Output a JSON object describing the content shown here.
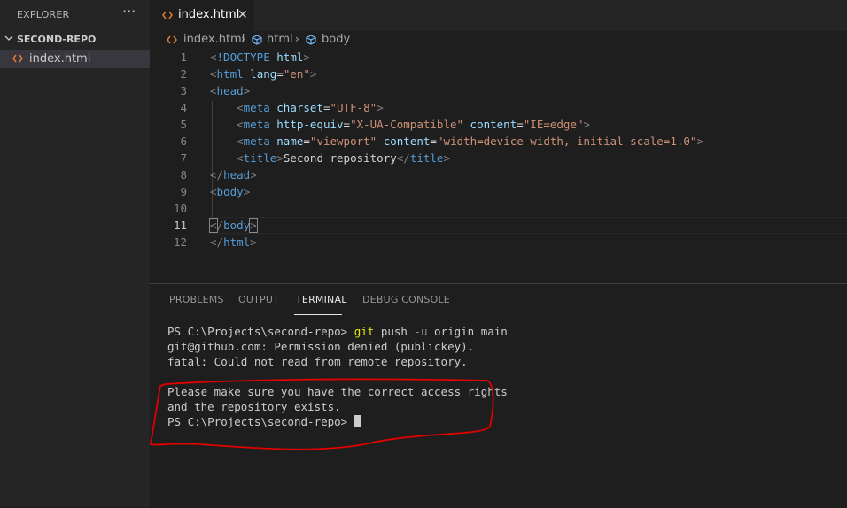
{
  "explorer": {
    "title": "EXPLORER",
    "more": "···",
    "folder": "SECOND-REPO",
    "file": "index.html"
  },
  "tab": {
    "label": "index.html",
    "close": "✕"
  },
  "breadcrumb": {
    "file": "index.html",
    "html": "html",
    "body": "body",
    "sep": "›"
  },
  "editor": {
    "line_numbers": [
      "1",
      "2",
      "3",
      "4",
      "5",
      "6",
      "7",
      "8",
      "9",
      "10",
      "11",
      "12"
    ],
    "active_line": 11
  },
  "panel": {
    "tabs": [
      "PROBLEMS",
      "OUTPUT",
      "TERMINAL",
      "DEBUG CONSOLE"
    ],
    "active_tab": "TERMINAL",
    "terminal": {
      "prompt": "PS C:\\Projects\\second-repo> ",
      "cmd_git": "git",
      "cmd_push": " push ",
      "cmd_flag": "-u",
      "cmd_rest": " origin main",
      "line2": "git@github.com: Permission denied (publickey).",
      "line3": "fatal: Could not read from remote repository.",
      "line5": "Please make sure you have the correct access rights",
      "line6": "and the repository exists.",
      "line7_prompt": "PS C:\\Projects\\second-repo> "
    }
  },
  "colors": {
    "tag": "#569cd6",
    "attr": "#9cdcfe",
    "string": "#ce9178",
    "annotation": "#e00000"
  }
}
